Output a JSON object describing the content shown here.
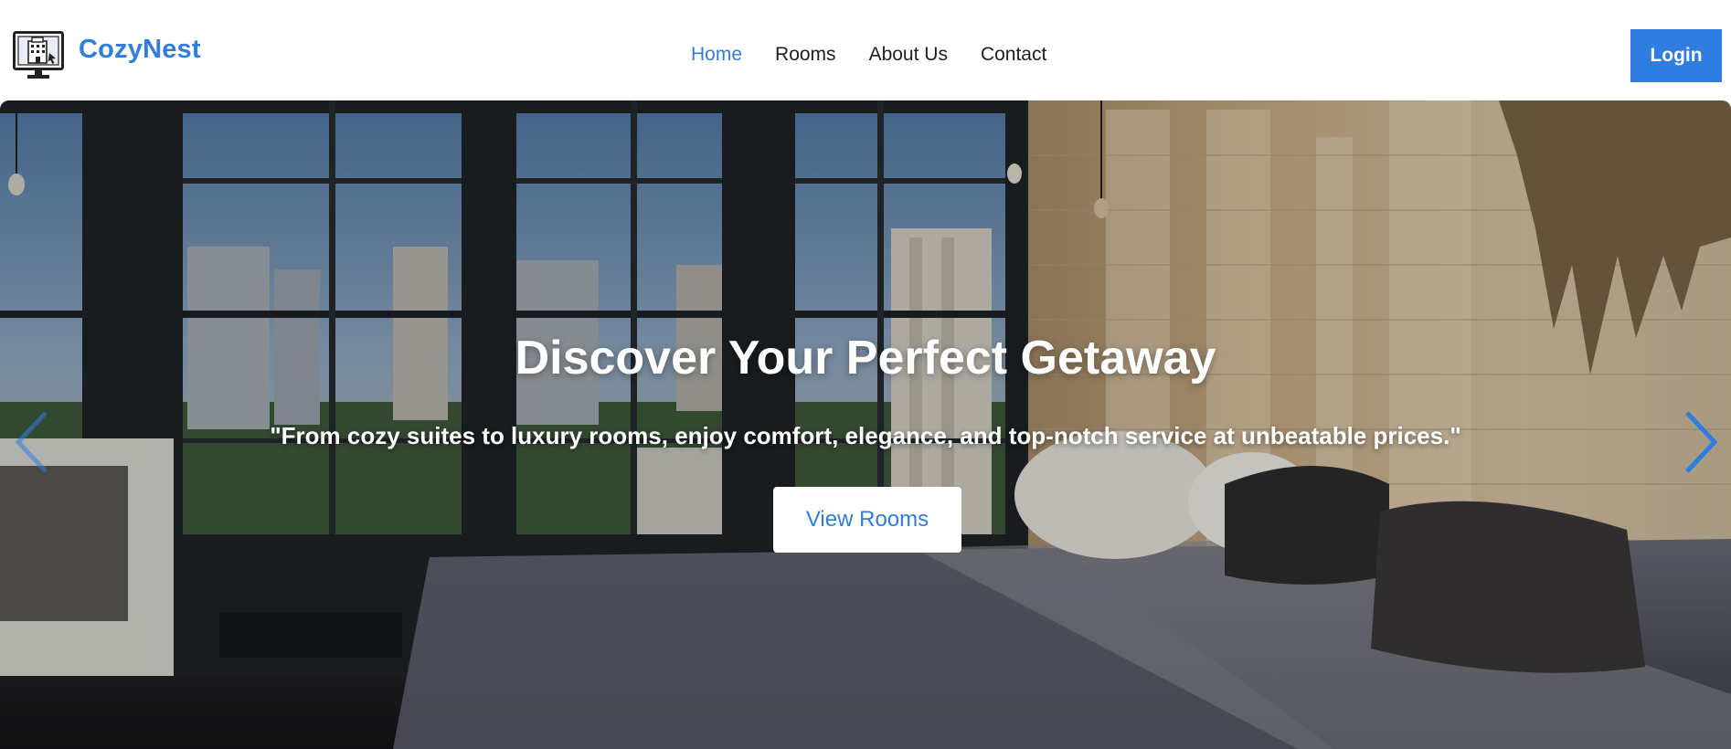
{
  "brand": {
    "name": "CozyNest",
    "logo_icon": "hotel-monitor-icon"
  },
  "nav": {
    "items": [
      {
        "label": "Home",
        "active": true
      },
      {
        "label": "Rooms",
        "active": false
      },
      {
        "label": "About Us",
        "active": false
      },
      {
        "label": "Contact",
        "active": false
      }
    ],
    "login_label": "Login"
  },
  "hero": {
    "title": "Discover Your Perfect Getaway",
    "tagline": "\"From cozy suites to luxury rooms, enjoy comfort, elegance, and top-notch service at unbeatable prices.\"",
    "cta_label": "View Rooms",
    "prev_icon": "chevron-left-icon",
    "next_icon": "chevron-right-icon"
  },
  "colors": {
    "accent": "#2f7de1",
    "nav_text": "#1f1f1f",
    "hero_text": "#ffffff"
  }
}
